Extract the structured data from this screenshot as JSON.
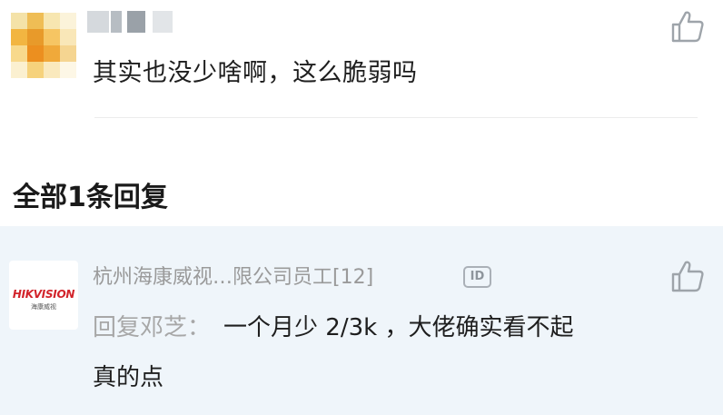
{
  "comment": {
    "text": "其实也没少啥啊，这么脆弱吗",
    "like_icon": "thumbs-up-icon"
  },
  "replies_section": {
    "title": "全部1条回复"
  },
  "reply": {
    "avatar_logo": "HIKVISION",
    "avatar_logo_sub": "海康威视",
    "username": "杭州海康威视…限公司员工[12]",
    "id_badge": "ID",
    "reply_prefix": "回复邓芝：",
    "text_line1": "一个月少 2/3k ，大佬确实看不起",
    "text_line2": "真的点",
    "like_icon": "thumbs-up-icon"
  },
  "colors": {
    "reply_background": "#eff5fa",
    "muted_text": "#9a9a9a",
    "brand_red": "#d2232a"
  }
}
